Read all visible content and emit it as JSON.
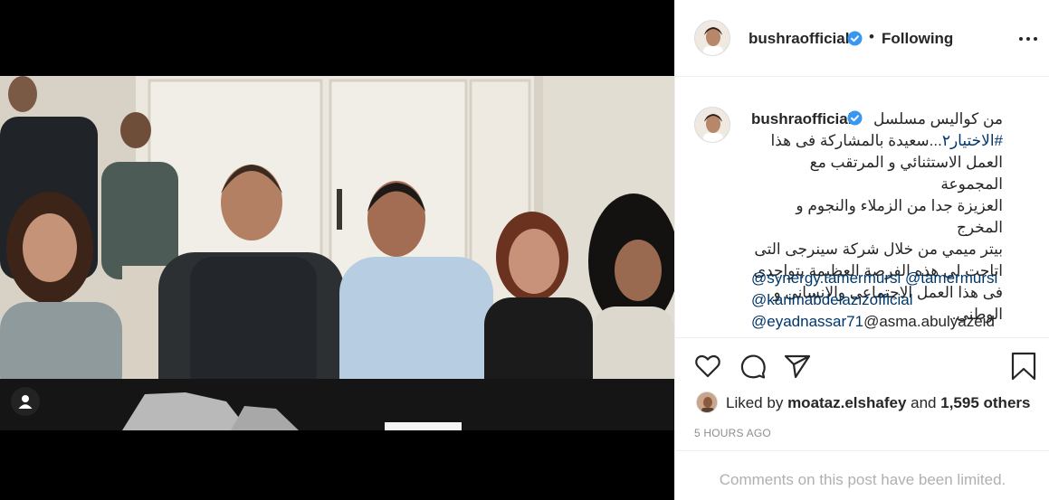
{
  "post": {
    "username": "bushraofficial",
    "verified": true,
    "follow_separator": "•",
    "follow_status": "Following",
    "more_icon": "more-horizontal-icon"
  },
  "caption": {
    "username": "bushraofficial",
    "line1_text": "من كواليس مسلسل",
    "line2_hashtag": "#الاختيار٢",
    "line2_text": "...سعيدة بالمشاركة فى هذا",
    "line3": "العمل الاستثنائي و المرتقب مع المجموعة",
    "line4": "العزيزة جدا من الزملاء والنجوم و المخرج",
    "line5": "بيتر ميمي من خلال شركة سينرجى التى",
    "line6": "اتاحت لى هذه الفرصة العظيمة بتواجدى",
    "line7": "فى هذا العمل الاجتماعى والانسانى و",
    "line8": "الوطنى.",
    "mention1": "@synergy.tamermursi",
    "mention2": "@tamermursi",
    "mention3": "@karimabdelazizofficial",
    "mention4": "@eyadnassar71",
    "mention5": "@asma.abulyazeid",
    "mention6_partial": "@..."
  },
  "actions": {
    "like_icon": "heart-icon",
    "comment_icon": "comment-icon",
    "share_icon": "send-icon",
    "save_icon": "bookmark-icon"
  },
  "likes": {
    "prefix": "Liked by",
    "user": "moataz.elshafey",
    "conj": "and",
    "count": "1,595 others"
  },
  "timestamp": "5 HOURS AGO",
  "comments_notice": "Comments on this post have been limited.",
  "media": {
    "tag_icon": "user-tag-icon"
  }
}
